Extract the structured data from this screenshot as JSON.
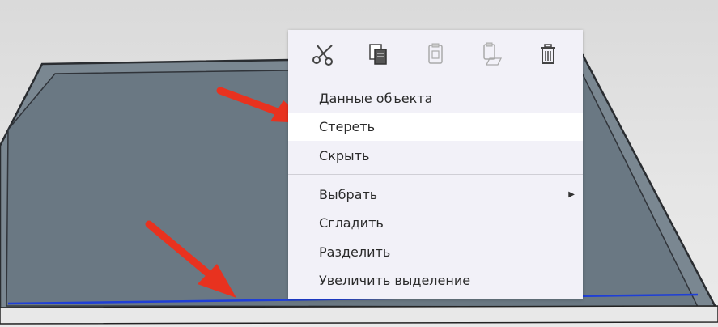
{
  "toolbar": {
    "icons": [
      "scissors-icon",
      "copy-icon",
      "paste-icon",
      "paste-in-place-icon",
      "trash-icon"
    ]
  },
  "menu": {
    "items": [
      {
        "label": "Данные объекта"
      },
      {
        "label": "Стереть"
      },
      {
        "label": "Скрыть"
      },
      {
        "label": "Выбрать",
        "has_submenu": true
      },
      {
        "label": "Сгладить"
      },
      {
        "label": "Разделить"
      },
      {
        "label": "Увеличить выделение"
      }
    ],
    "highlighted_item": "Стереть"
  },
  "colors": {
    "face": "#6b7a86",
    "edge": "#2a2d31",
    "selected_edge": "#1f3fd6",
    "menu_bg": "#f2f1f8",
    "menu_hover": "#ffffff",
    "arrow": "#e8321f"
  }
}
